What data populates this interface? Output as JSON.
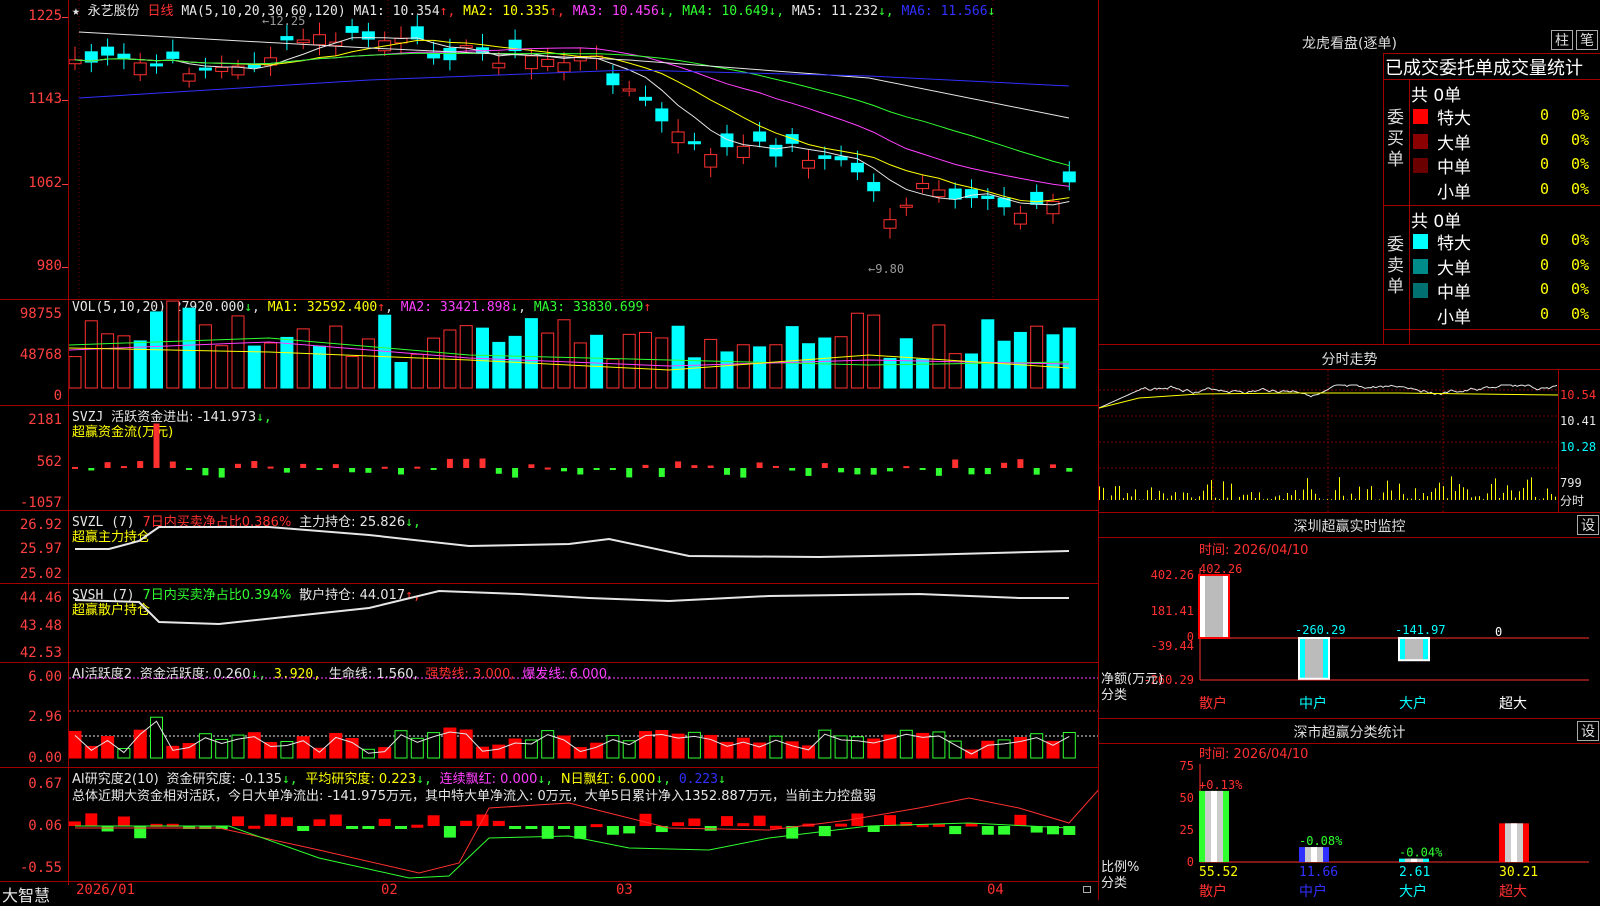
{
  "main_chart": {
    "star": "★",
    "stock_name": "永艺股份",
    "period": "日线",
    "ma_label": "MA(5,10,20,30,60,120)",
    "ma_values": [
      {
        "label": "MA1:",
        "value": "10.354",
        "arrow": "↑",
        "color": "#e6e6e6"
      },
      {
        "label": "MA2:",
        "value": "10.335",
        "arrow": "↑",
        "color": "#ffff00"
      },
      {
        "label": "MA3:",
        "value": "10.456",
        "arrow": "↓",
        "color": "#ff40ff"
      },
      {
        "label": "MA4:",
        "value": "10.649",
        "arrow": "↓",
        "color": "#30ff30"
      },
      {
        "label": "MA5:",
        "value": "11.232",
        "arrow": "↓",
        "color": "#e6e6e6"
      },
      {
        "label": "MA6:",
        "value": "11.566",
        "arrow": "↓",
        "color": "#3030ff"
      }
    ],
    "high_marker": "←12.25",
    "low_marker": "←9.80",
    "y_labels": [
      "1225",
      "1143",
      "1062",
      "980"
    ]
  },
  "vol_panel": {
    "title": "VOL(5,10,20)",
    "value": "27920.000",
    "arrow": "↓",
    "ma1": "MA1: 32592.400",
    "ma1_arrow": "↑",
    "ma2": "MA2: 33421.898",
    "ma2_arrow": "↓",
    "ma3": "MA3: 33830.699",
    "ma3_arrow": "↑",
    "y_labels": [
      "98755",
      "48768",
      "0"
    ]
  },
  "svzj_panel": {
    "title": "SVZJ",
    "label": "活跃资金进出: -141.973",
    "arrow": "↓,",
    "subtitle": "超赢资金流(万元)",
    "y_labels": [
      "2181",
      "562",
      "-1057"
    ]
  },
  "svzl_panel": {
    "title": "SVZL (7)",
    "ratio": "7日内买卖净占比0.386%",
    "label": "主力持仓: 25.826",
    "arrow": "↓,",
    "subtitle": "超赢主力持仓",
    "y_labels": [
      "26.92",
      "25.97",
      "25.02"
    ]
  },
  "svsh_panel": {
    "title": "SVSH (7)",
    "ratio": "7日内买卖净占比0.394%",
    "label": "散户持仓: 44.017",
    "arrow": "↑,",
    "subtitle": "超赢散户持仓",
    "y_labels": [
      "44.46",
      "43.48",
      "42.53"
    ]
  },
  "ai_active_panel": {
    "title": "AI活跃度2",
    "label": "资金活跃度: 0.260",
    "arrow": "↓,",
    "value2": "3.920,",
    "life": "生命线: 1.560,",
    "strong": "强势线: 3.000,",
    "burst": "爆发线: 6.000,",
    "y_labels": [
      "6.00",
      "2.96",
      "0.00"
    ]
  },
  "ai_research_panel": {
    "title": "AI研究度2(10)",
    "label": "资金研究度: -0.135",
    "arrow": "↓,",
    "avg": "平均研究度: 0.223",
    "avg_arrow": "↓,",
    "streak": "连续飘红: 0.000",
    "streak_arrow": "↓,",
    "nday": "N日飘红: 6.000",
    "nday_arrow": "↓,",
    "last": "0.223",
    "last_arrow": "↓",
    "summary": "总体近期大资金相对活跃，今日大单净流出: -141.975万元，其中特大单净流入: 0万元，大单5日累计净入1352.887万元，当前主力控盘弱",
    "y_labels": [
      "0.67",
      "0.06",
      "-0.55"
    ]
  },
  "x_axis": {
    "labels": [
      "2026/01",
      "02",
      "03",
      "04"
    ],
    "corner": "大智慧"
  },
  "dragon_panel": {
    "title": "龙虎看盘(逐单)",
    "btn_bar": "柱",
    "btn_pen": "笔",
    "header": "已成交委托单成交量统计",
    "buy": {
      "side_label": "委买单",
      "total": "共 0单",
      "rows": [
        {
          "name": "特大",
          "value": "0",
          "pct": "0%",
          "color": "#ff0000"
        },
        {
          "name": "大单",
          "value": "0",
          "pct": "0%",
          "color": "#8b0000"
        },
        {
          "name": "中单",
          "value": "0",
          "pct": "0%",
          "color": "#6b0000"
        },
        {
          "name": "小单",
          "value": "0",
          "pct": "0%",
          "color": "#000000"
        }
      ]
    },
    "sell": {
      "side_label": "委卖单",
      "total": "共 0单",
      "rows": [
        {
          "name": "特大",
          "value": "0",
          "pct": "0%",
          "color": "#00ffff"
        },
        {
          "name": "大单",
          "value": "0",
          "pct": "0%",
          "color": "#008b8b"
        },
        {
          "name": "中单",
          "value": "0",
          "pct": "0%",
          "color": "#007070"
        },
        {
          "name": "小单",
          "value": "0",
          "pct": "0%",
          "color": "#000000"
        }
      ]
    }
  },
  "intraday_panel": {
    "title": "分时走势",
    "price_labels": [
      "10.54",
      "10.41",
      "10.28"
    ],
    "vol_label": "799",
    "vol_unit": "分时"
  },
  "sz_monitor": {
    "title": "深圳超赢实时监控",
    "settings": "设",
    "time": "时间: 2026/04/10",
    "y_labels": [
      "402.26",
      "181.41",
      "0",
      "-39.44",
      "-260.29"
    ],
    "unit": "净额(万元)",
    "cat_label": "分类",
    "bars": [
      {
        "cat": "散户",
        "value": 402.26,
        "label": "402.26"
      },
      {
        "cat": "中户",
        "value": -260.29,
        "label": "-260.29"
      },
      {
        "cat": "大户",
        "value": -141.97,
        "label": "-141.97"
      },
      {
        "cat": "超大",
        "value": 0,
        "label": "0"
      }
    ]
  },
  "sz_class": {
    "title": "深市超赢分类统计",
    "settings": "设",
    "time": "时间: 2026/04/10",
    "y_labels": [
      "75",
      "50",
      "25",
      "0"
    ],
    "unit": "比例%",
    "cat_label": "分类",
    "bars": [
      {
        "cat": "散户",
        "value": 55.52,
        "label": "55.52",
        "change": "+0.13%"
      },
      {
        "cat": "中户",
        "value": 11.66,
        "label": "11.66",
        "change": "-0.08%"
      },
      {
        "cat": "大户",
        "value": 2.61,
        "label": "2.61",
        "change": "-0.04%"
      },
      {
        "cat": "超大",
        "value": 30.21,
        "label": "30.21",
        "change": ""
      }
    ]
  },
  "colors": {
    "up": "#ff3030",
    "down": "#00ffff",
    "frame": "#a00000",
    "ma1": "#e6e6e6",
    "ma2": "#ffff00",
    "ma3": "#ff40ff",
    "ma4": "#30ff30",
    "ma5": "#e6e6e6",
    "ma6": "#3030ff"
  }
}
